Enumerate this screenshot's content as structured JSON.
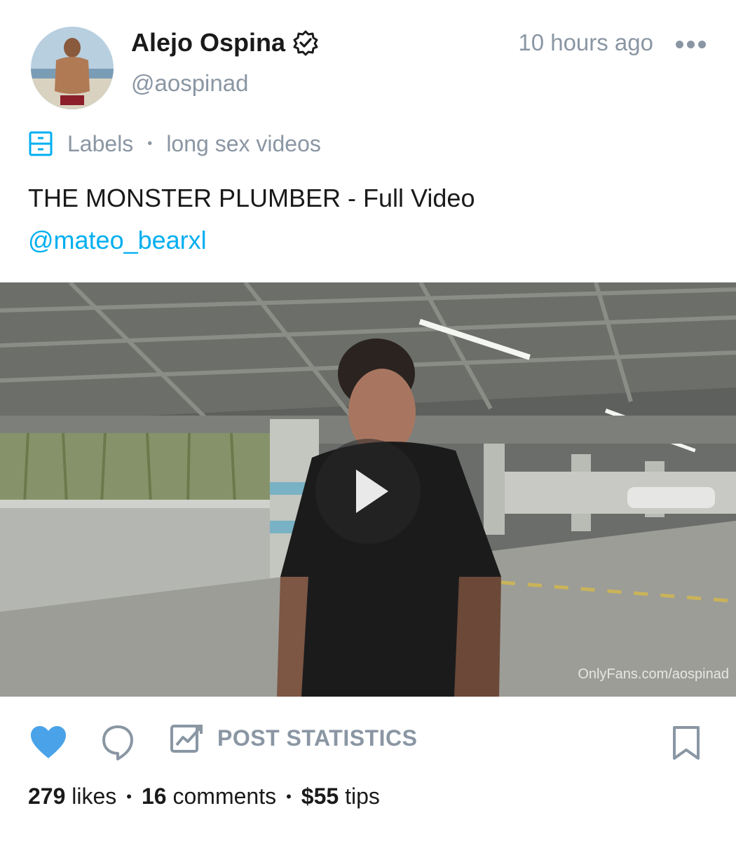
{
  "author": {
    "name": "Alejo Ospina",
    "handle": "@aospinad",
    "verified_icon": "verified-badge-icon",
    "avatar_icon": "avatar"
  },
  "post": {
    "time": "10 hours ago",
    "labels_label": "Labels",
    "label_value": "long sex videos",
    "title": "THE MONSTER PLUMBER - Full Video",
    "mention": "@mateo_bearxl",
    "watermark": "OnlyFans.com/aospinad"
  },
  "actions": {
    "stats_label": "POST STATISTICS",
    "like_icon": "heart-icon",
    "comment_icon": "comment-icon",
    "stats_icon": "chart-icon",
    "bookmark_icon": "bookmark-icon"
  },
  "counts": {
    "likes_num": "279",
    "likes_word": "likes",
    "comments_num": "16",
    "comments_word": "comments",
    "tips_num": "$55",
    "tips_word": "tips",
    "separator": "•"
  },
  "colors": {
    "accent": "#00aff0",
    "muted": "#8a96a3",
    "like": "#1da1f2"
  }
}
